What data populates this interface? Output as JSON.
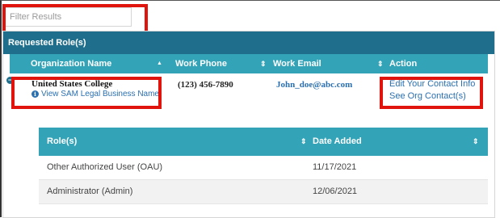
{
  "filter": {
    "placeholder": "Filter Results",
    "value": ""
  },
  "panel": {
    "title": "Requested Role(s)"
  },
  "org_table": {
    "columns": {
      "org": "Organization Name",
      "phone": "Work Phone",
      "email": "Work Email",
      "action": "Action"
    },
    "sort_icons": {
      "asc": "▲",
      "both": "⇕"
    },
    "row": {
      "org_name": "United States College",
      "sam_link": "View SAM Legal Business Name",
      "phone": "(123) 456-7890",
      "email": "John_doe@abc.com",
      "action_edit": "Edit Your Contact Info",
      "action_see": "See Org Contact(s)"
    }
  },
  "roles_table": {
    "columns": {
      "role": "Role(s)",
      "date": "Date Added"
    },
    "rows": [
      {
        "role": "Other Authorized User (OAU)",
        "date": "11/17/2021"
      },
      {
        "role": "Administrator (Admin)",
        "date": "12/06/2021"
      }
    ]
  },
  "colors": {
    "header_dark": "#1f6f8c",
    "header_light": "#33a3b8",
    "link": "#2a6fb0",
    "highlight": "#e0140c"
  }
}
